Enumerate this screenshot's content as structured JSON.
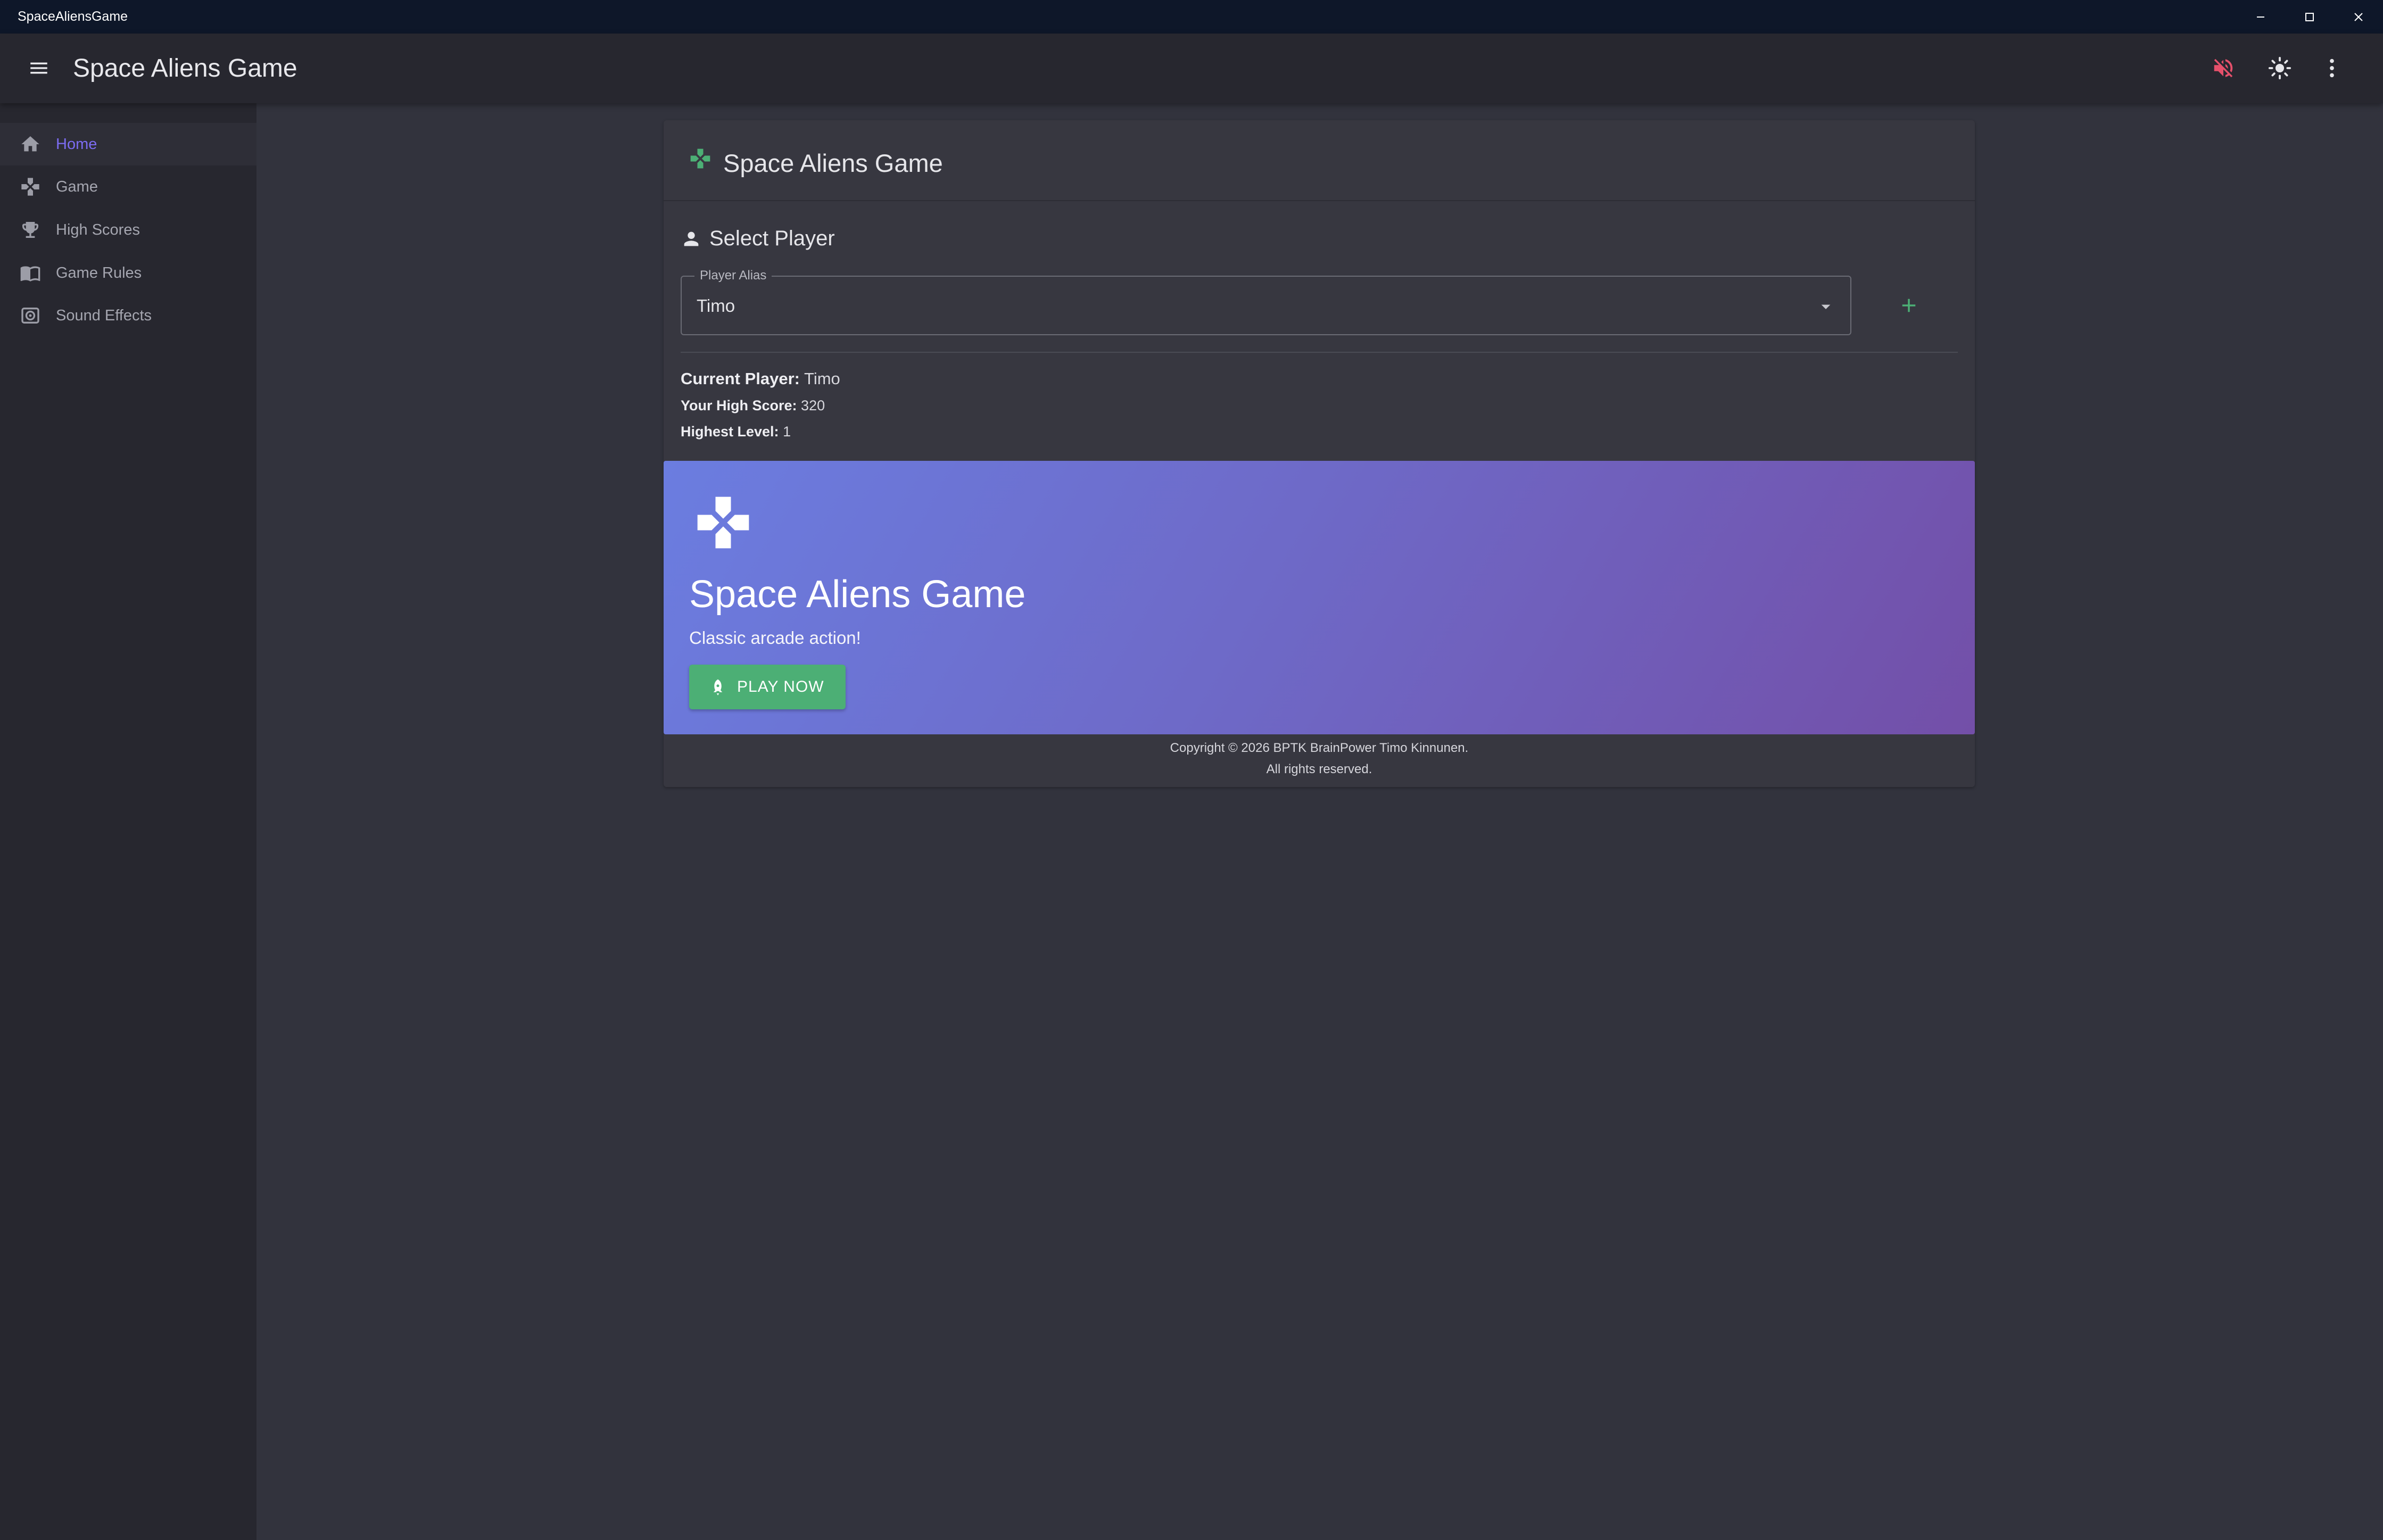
{
  "window": {
    "title": "SpaceAliensGame"
  },
  "appbar": {
    "title": "Space Aliens Game"
  },
  "sidebar": {
    "items": [
      {
        "label": "Home",
        "icon": "home-icon",
        "active": true
      },
      {
        "label": "Game",
        "icon": "gamepad-icon",
        "active": false
      },
      {
        "label": "High Scores",
        "icon": "trophy-icon",
        "active": false
      },
      {
        "label": "Game Rules",
        "icon": "book-icon",
        "active": false
      },
      {
        "label": "Sound Effects",
        "icon": "speaker-icon",
        "active": false
      }
    ]
  },
  "card": {
    "title": "Space Aliens Game",
    "select_player_title": "Select Player",
    "alias": {
      "label": "Player Alias",
      "value": "Timo"
    },
    "current_player": {
      "label": "Current Player:",
      "value": "Timo"
    },
    "high_score": {
      "label": "Your High Score:",
      "value": "320"
    },
    "highest_level": {
      "label": "Highest Level:",
      "value": "1"
    }
  },
  "hero": {
    "title": "Space Aliens Game",
    "subtitle": "Classic arcade action!",
    "play_label": "PLAY NOW"
  },
  "footer": {
    "line1": "Copyright © 2026 BPTK BrainPower Timo Kinnunen.",
    "line2": "All rights reserved."
  },
  "colors": {
    "accent": "#7c6cf2",
    "success": "#4caf75",
    "mute_icon": "#e5506b",
    "background": "#32333d",
    "surface": "#373740"
  }
}
